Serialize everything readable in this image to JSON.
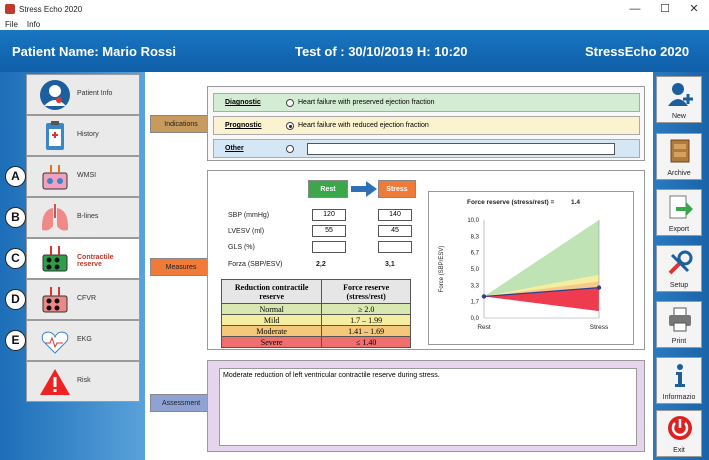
{
  "window": {
    "title": "Stress Echo 2020",
    "minimize": "—",
    "maximize": "☐",
    "close": "✕"
  },
  "menu": {
    "file": "File",
    "info": "Info"
  },
  "header": {
    "patient": "Patient Name: Mario Rossi",
    "test": "Test of : 30/10/2019 H: 10:20",
    "brand": "StressEcho 2020"
  },
  "sidebar": {
    "items": [
      {
        "label": "Patient Info",
        "letter": ""
      },
      {
        "label": "History",
        "letter": ""
      },
      {
        "label": "WMSI",
        "letter": "A"
      },
      {
        "label": "B-lines",
        "letter": "B"
      },
      {
        "label": "Contractile reserve",
        "letter": "C"
      },
      {
        "label": "CFVR",
        "letter": "D"
      },
      {
        "label": "EKG",
        "letter": "E"
      },
      {
        "label": "Risk",
        "letter": ""
      }
    ]
  },
  "toolbar": {
    "new": "New",
    "archive": "Archive",
    "export": "Export",
    "setup": "Setup",
    "print": "Print",
    "info": "Informazio",
    "exit": "Exit"
  },
  "indications": {
    "tag": "Indications",
    "diagnostic_label": "Diagnostic",
    "diagnostic_text": "Heart failure with preserved ejection fraction",
    "prognostic_label": "Prognostic",
    "prognostic_text": "Heart failure with reduced ejection fraction",
    "other_label": "Other",
    "other_value": ""
  },
  "measures": {
    "tag": "Measures",
    "rest": "Rest",
    "stress": "Stress",
    "sbp_label": "SBP (mmHg)",
    "sbp_rest": "120",
    "sbp_stress": "140",
    "lvesv_label": "LVESV  (ml)",
    "lvesv_rest": "55",
    "lvesv_stress": "45",
    "gls_label": "GLS (%)",
    "gls_rest": "",
    "gls_stress": "",
    "forza_label": "Forza (SBP/ESV)",
    "forza_rest": "2,2",
    "forza_stress": "3,1"
  },
  "reserve_table": {
    "header1": "Reduction contractile reserve",
    "header2": "Force reserve (stress/rest)",
    "rows": [
      {
        "name": "Normal",
        "value": "≥ 2.0",
        "color": "#d8e8b0"
      },
      {
        "name": "Mild",
        "value": "1.7 – 1.99",
        "color": "#f5eea0"
      },
      {
        "name": "Moderate",
        "value": "1.41 – 1.69",
        "color": "#f4c77a"
      },
      {
        "name": "Severe",
        "value": "≤ 1.40",
        "color": "#ef6f6f"
      }
    ]
  },
  "chart_data": {
    "type": "line",
    "title": "Force reserve (stress/rest) =",
    "title_value": "1.4",
    "ylabel": "Force (SBP/ESV)",
    "categories": [
      "Rest",
      "Stress"
    ],
    "yticks": [
      "10,0",
      "8,3",
      "6,7",
      "5,0",
      "3,3",
      "1,7",
      "0,0"
    ],
    "ylim": [
      0,
      10
    ],
    "series": [
      {
        "values": [
          2.2,
          3.1
        ]
      }
    ],
    "bands": {
      "normal": "#bfe3b4",
      "mild": "#f5ee9a",
      "moderate": "#f6c98e",
      "severe": "#ee3b4d"
    }
  },
  "assessment": {
    "tag": "Assessment",
    "text": "Moderate reduction of left ventricular contractile reserve during stress."
  }
}
